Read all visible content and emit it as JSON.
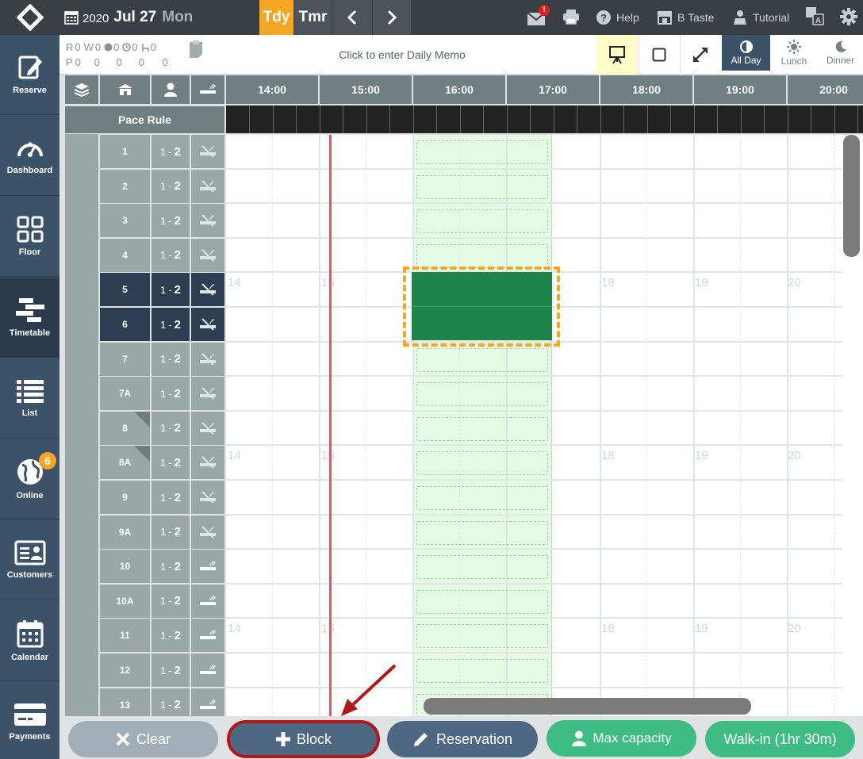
{
  "topbar": {
    "year": "2020",
    "date": "Jul 27",
    "weekday": "Mon",
    "today_label": "Tdy",
    "tomorrow_label": "Tmr",
    "help_label": "Help",
    "store_label": "B Taste",
    "tutorial_label": "Tutorial",
    "mail_badge": "!",
    "icons": [
      "logo-icon",
      "calendar-icon",
      "chevron-left-icon",
      "chevron-right-icon",
      "mail-icon",
      "printer-icon",
      "help-icon",
      "store-icon",
      "tutorial-icon",
      "language-icon",
      "gear-icon"
    ]
  },
  "sidebar": {
    "items": [
      {
        "label": "Reserve",
        "icon": "reserve-icon"
      },
      {
        "label": "Dashboard",
        "icon": "dashboard-icon"
      },
      {
        "label": "Floor",
        "icon": "floor-icon"
      },
      {
        "label": "Timetable",
        "icon": "timetable-icon",
        "active": true
      },
      {
        "label": "List",
        "icon": "list-icon"
      },
      {
        "label": "Online",
        "icon": "globe-icon",
        "badge": "6"
      },
      {
        "label": "Customers",
        "icon": "customers-icon"
      },
      {
        "label": "Calendar",
        "icon": "calendar-icon"
      },
      {
        "label": "Payments",
        "icon": "payments-icon"
      }
    ]
  },
  "infobar": {
    "r_label": "R",
    "w_label": "W",
    "r_value": "0",
    "w_value": "0",
    "c1_value": "0",
    "c2_value": "0",
    "c3_value": "0",
    "p_label": "P",
    "p_values": [
      "0",
      "0",
      "0",
      "0",
      "0"
    ],
    "memo_placeholder": "Click to enter Daily Memo",
    "view_all_day": "All Day",
    "view_lunch": "Lunch",
    "view_dinner": "Dinner"
  },
  "grid": {
    "pace_rule_label": "Pace Rule",
    "times": [
      "14:00",
      "15:00",
      "16:00",
      "17:00",
      "18:00",
      "19:00",
      "20:00"
    ],
    "ghost_hours": [
      "14",
      "15",
      "18",
      "19",
      "20"
    ],
    "tables": [
      {
        "no": "1",
        "min": "1",
        "max": "2",
        "smoking": false
      },
      {
        "no": "2",
        "min": "1",
        "max": "2",
        "smoking": false
      },
      {
        "no": "3",
        "min": "1",
        "max": "2",
        "smoking": false
      },
      {
        "no": "4",
        "min": "1",
        "max": "2",
        "smoking": false
      },
      {
        "no": "5",
        "min": "1",
        "max": "2",
        "smoking": false,
        "selected": true
      },
      {
        "no": "6",
        "min": "1",
        "max": "2",
        "smoking": false,
        "selected": true
      },
      {
        "no": "7",
        "min": "1",
        "max": "2",
        "smoking": false
      },
      {
        "no": "7A",
        "min": "1",
        "max": "2",
        "smoking": false
      },
      {
        "no": "8",
        "min": "1",
        "max": "2",
        "smoking": false,
        "linked": true
      },
      {
        "no": "8A",
        "min": "1",
        "max": "2",
        "smoking": false,
        "linked": true
      },
      {
        "no": "9",
        "min": "1",
        "max": "2",
        "smoking": false
      },
      {
        "no": "9A",
        "min": "1",
        "max": "2",
        "smoking": false
      },
      {
        "no": "10",
        "min": "1",
        "max": "2",
        "smoking": true
      },
      {
        "no": "10A",
        "min": "1",
        "max": "2",
        "smoking": true
      },
      {
        "no": "11",
        "min": "1",
        "max": "2",
        "smoking": true
      },
      {
        "no": "12",
        "min": "1",
        "max": "2",
        "smoking": true
      },
      {
        "no": "13",
        "min": "1",
        "max": "2",
        "smoking": true
      }
    ]
  },
  "actions": {
    "clear": "Clear",
    "block": "Block",
    "reservation": "Reservation",
    "max_capacity": "Max capacity",
    "walkin": "Walk-in (1hr 30m)"
  },
  "colors": {
    "accent_orange": "#f5a623",
    "selection_green": "#1e8449",
    "available_green": "#e3fae3",
    "nav_blue": "#3c5269",
    "now_line": "#c0393b",
    "highlight_red": "#b3171b"
  }
}
